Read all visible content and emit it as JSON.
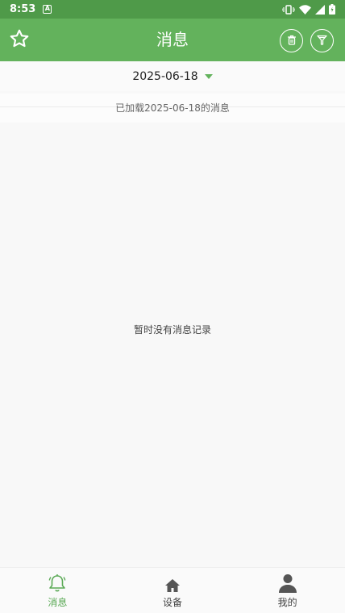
{
  "status_bar": {
    "time": "8:53",
    "notification_icon_text": "A"
  },
  "app_bar": {
    "title": "消息"
  },
  "date_picker": {
    "value": "2025-06-18"
  },
  "notice": {
    "text": "已加载2025-06-18的消息"
  },
  "empty_state": {
    "text": "暂时没有消息记录"
  },
  "bottom_nav": {
    "items": [
      {
        "label": "消息",
        "icon": "bell-icon",
        "active": true
      },
      {
        "label": "设备",
        "icon": "home-icon",
        "active": false
      },
      {
        "label": "我的",
        "icon": "person-icon",
        "active": false
      }
    ]
  },
  "colors": {
    "primary": "#63b25c",
    "status_bar": "#4f9a49",
    "background": "#f8f8f8"
  }
}
